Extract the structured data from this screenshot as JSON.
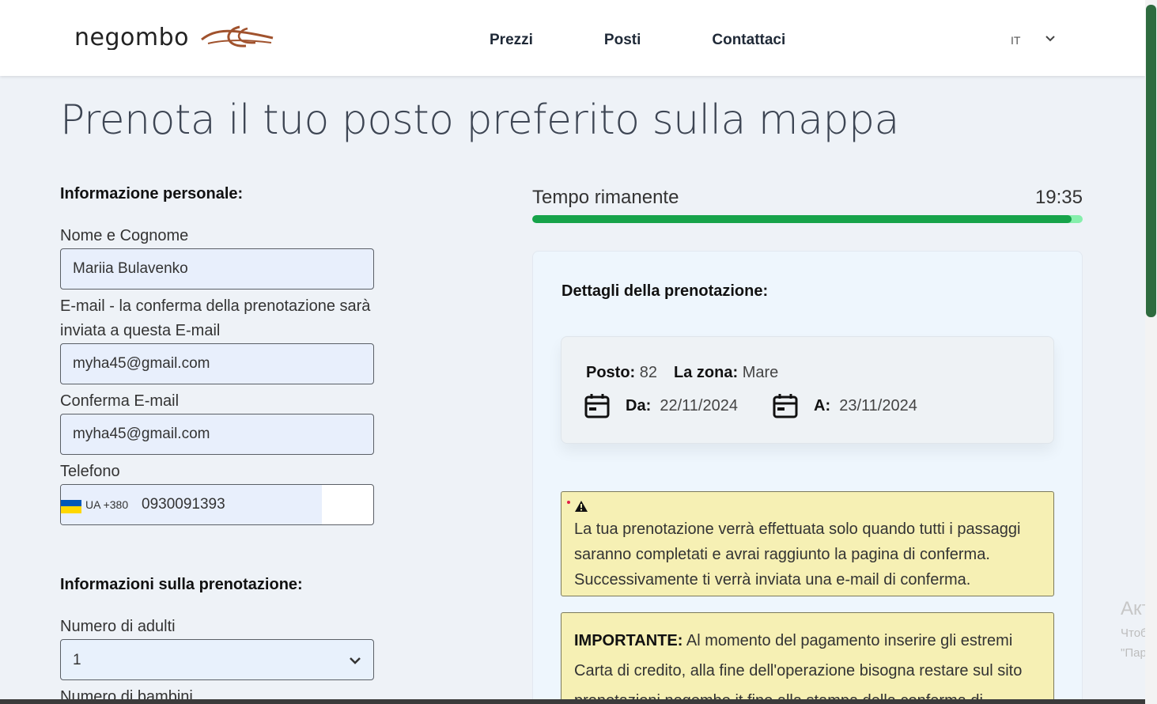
{
  "header": {
    "logo_text": "negombo",
    "nav": [
      "Prezzi",
      "Posti",
      "Contattaci"
    ],
    "language": "IT"
  },
  "page_title": "Prenota il tuo posto preferito sulla mappa",
  "personal": {
    "section_title": "Informazione personale:",
    "name_label": "Nome e Cognome",
    "name_value": "Mariia Bulavenko",
    "email_label": "E-mail - la conferma della prenotazione sarà inviata a questa E-mail",
    "email_value": "myha45@gmail.com",
    "confirm_label": "Conferma E-mail",
    "confirm_value": "myha45@gmail.com",
    "phone_label": "Telefono",
    "phone_country": "UA +380",
    "phone_value": "0930091393"
  },
  "booking": {
    "section_title": "Informazioni sulla prenotazione:",
    "adults_label": "Numero di adulti",
    "adults_value": "1",
    "children_label": "Numero di bambini"
  },
  "timer": {
    "label": "Tempo rimanente",
    "value": "19:35",
    "progress": 0.98
  },
  "details": {
    "title": "Dettagli della prenotazione:",
    "posto_label": "Posto:",
    "posto_value": "82",
    "zona_label": "La zona:",
    "zona_value": "Mare",
    "da_label": "Da:",
    "da_value": "22/11/2024",
    "a_label": "A:",
    "a_value": "23/11/2024"
  },
  "warning": {
    "text": "La tua prenotazione verrà effettuata solo quando tutti i passaggi saranno completati e avrai raggiunto la pagina di conferma. Successivamente ti verrà inviata una e-mail di conferma."
  },
  "important": {
    "label": "IMPORTANTE:",
    "text": "Al momento del pagamento inserire gli estremi Carta di credito, alla fine dell'operazione bisogna restare sul sito prenotazioni.negombo.it fino alla stampa della conferma di"
  },
  "windows_overlay": {
    "line1": "Акти",
    "line2": "Чтобы",
    "line3": "\"Пара"
  },
  "colors": {
    "progress_fill": "#16a34a",
    "progress_track": "#86efac",
    "warning_bg": "#f6f0b4",
    "logo_accent": "#a0522d"
  }
}
